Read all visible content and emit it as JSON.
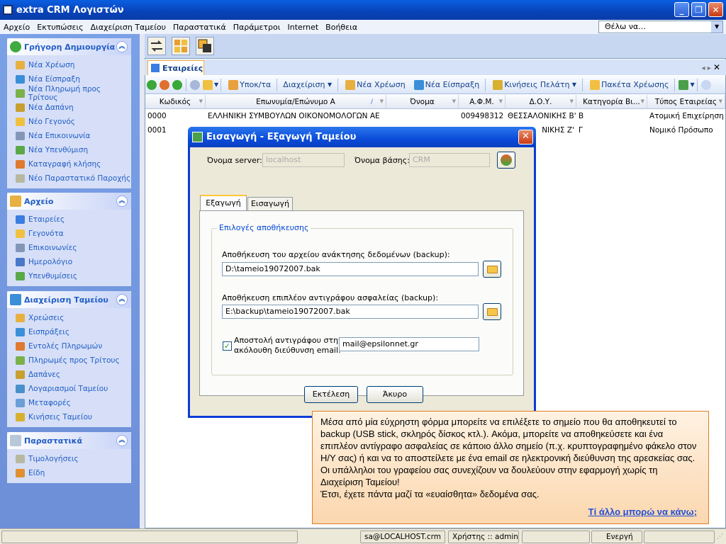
{
  "window": {
    "title": "extra CRM Λογιστών"
  },
  "menu": [
    "Αρχείο",
    "Εκτυπώσεις",
    "Διαχείριση Ταμείου",
    "Παραστατικά",
    "Παράμετροι",
    "Internet",
    "Βοήθεια"
  ],
  "search": {
    "value": "Θέλω να..."
  },
  "sidebar": {
    "groups": [
      {
        "title": "Γρήγορη Δημιουργία",
        "items": [
          "Νέα Χρέωση",
          "Νέα Είσπραξη",
          "Νέα Πληρωμή προς Τρίτους",
          "Νέα Δαπάνη",
          "Νέο Γεγονός",
          "Νέα Επικοινωνία",
          "Νέα Υπενθύμιση",
          "Καταγραφή κλήσης",
          "Νέο Παραστατικό Παροχής"
        ]
      },
      {
        "title": "Αρχείο",
        "items": [
          "Εταιρείες",
          "Γεγονότα",
          "Επικοινωνίες",
          "Ημερολόγιο",
          "Υπενθυμίσεις"
        ]
      },
      {
        "title": "Διαχείριση Ταμείου",
        "items": [
          "Χρεώσεις",
          "Εισπράξεις",
          "Εντολές Πληρωμών",
          "Πληρωμές προς Τρίτους",
          "Δαπάνες",
          "Λογαριασμοί Ταμείου",
          "Μεταφορές",
          "Κινήσεις Ταμείου"
        ]
      },
      {
        "title": "Παραστατικά",
        "items": [
          "Τιμολογήσεις",
          "Είδη"
        ]
      }
    ]
  },
  "doc_tab": {
    "label": "Εταιρείες"
  },
  "toolbar": {
    "ypokta": "Υποκ/τα",
    "diaxeirisi": "Διαχείριση",
    "nea_xreosi": "Νέα Χρέωση",
    "nea_eispraxi": "Νέα Είσπραξη",
    "kiniseis": "Κινήσεις Πελάτη",
    "paketa": "Πακέτα Χρέωσης"
  },
  "grid": {
    "headers": [
      "Κωδικός",
      "Επωνυμία/Επώνυμο Α",
      "Όνομα",
      "Α.Φ.Μ.",
      "Δ.Ο.Υ.",
      "Κατηγορία Βι...",
      "Τύπος Εταιρείας"
    ],
    "rows": [
      [
        "0000",
        "ΕΛΛΗΝΙΚΗ ΣΥΜΒΟΥΛΩΝ ΟΙΚΟΝΟΜΟΛΟΓΩΝ ΑΕ",
        "",
        "009498312",
        "ΘΕΣΣΑΛΟΝΙΚΗΣ Β'",
        "Β",
        "Ατομική Επιχείρηση"
      ],
      [
        "0001",
        "",
        "",
        "",
        "ΝΙΚΗΣ Ζ'",
        "Γ",
        "Νομικό Πρόσωπο"
      ]
    ]
  },
  "dialog": {
    "title": "Εισαγωγή - Εξαγωγή Ταμείου",
    "server_label": "Όνομα server:",
    "server_value": "localhost",
    "db_label": "Όνομα βάσης:",
    "db_value": "CRM",
    "tab_export": "Εξαγωγή",
    "tab_import": "Εισαγωγή",
    "group_title": "Επιλογές αποθήκευσης",
    "backup_label": "Αποθήκευση του αρχείου ανάκτησης δεδομένων (backup):",
    "backup_value": "D:\\tameio19072007.bak",
    "extra_label": "Αποθήκευση επιπλέον αντιγράφου ασφαλείας (backup):",
    "extra_value": "E:\\backup\\tameio19072007.bak",
    "email_check_label_1": "Αποστολή αντιγράφου στην",
    "email_check_label_2": "ακόλουθη διεύθυνση email:",
    "email_checked": true,
    "email_value": "mail@epsilonnet.gr",
    "run_button": "Εκτέλεση",
    "cancel_button": "Άκυρο"
  },
  "tooltip": {
    "text": "Μέσα από μία εύχρηστη φόρμα μπορείτε να επιλέξετε το σημείο που θα αποθηκευτεί το backup (USB stick, σκληρός δίσκος κτλ.). Ακόμα, μπορείτε να αποθηκεύσετε και ένα επιπλέον αντίγραφο ασφαλείας σε κάποιο άλλο σημείο (π.χ. κρυπτογραφημένο φάκελο στον Η/Υ σας) ή και να το αποστείλετε με ένα email σε ηλεκτρονική διεύθυνση της αρεσκείας σας. Οι υπάλληλοι του γραφείου σας συνεχίζουν να δουλεύουν στην εφαρμογή χωρίς τη Διαχείριση Ταμείου!",
    "text2": "Έτσι, έχετε πάντα μαζί τα «ευαίσθητα» δεδομένα σας.",
    "link": "Τί άλλο μπορώ να κάνω;"
  },
  "status": {
    "user_host": "sa@LOCALHOST.crm",
    "user": "Χρήστης :: admin",
    "state": "Ενεργή"
  }
}
